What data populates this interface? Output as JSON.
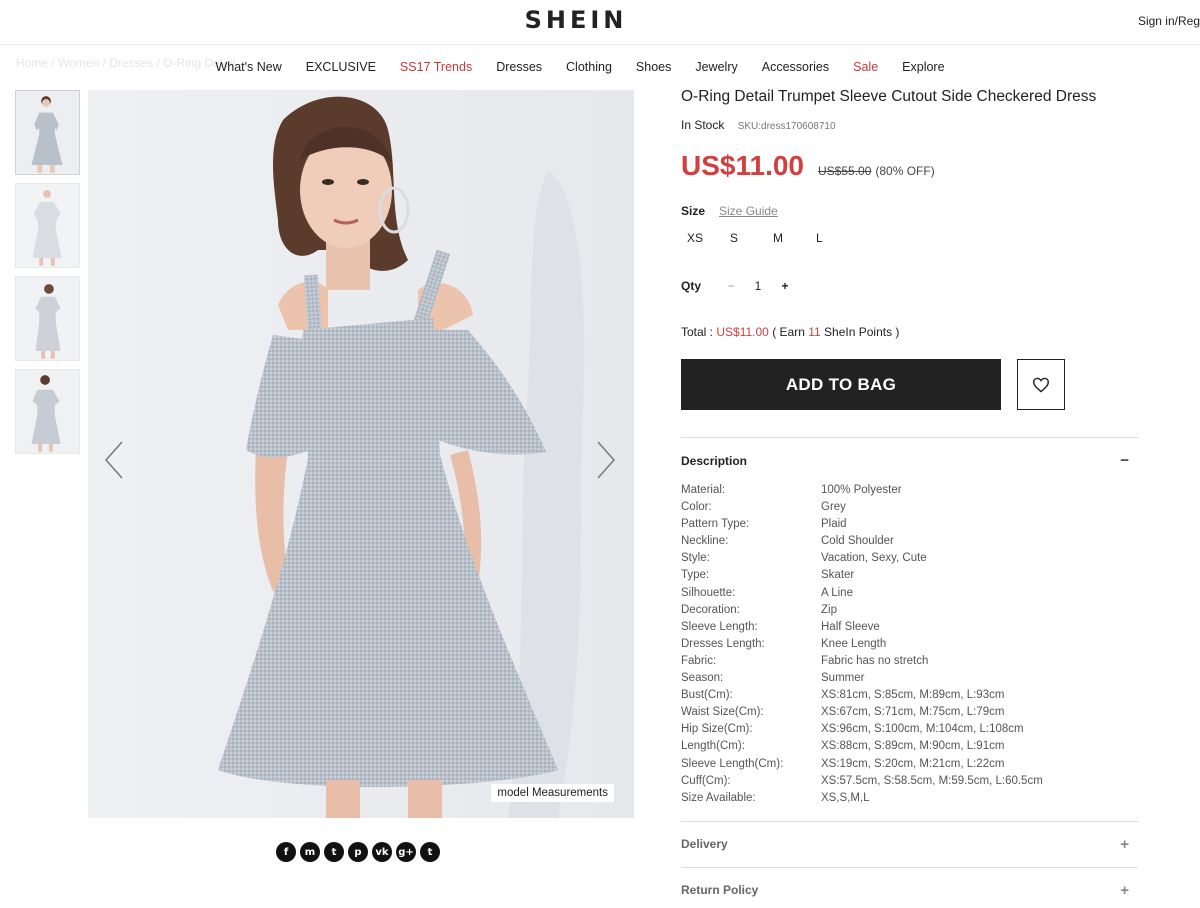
{
  "header": {
    "logo": "SHEIN",
    "signin": "Sign in/Reg"
  },
  "breadcrumb": "Home / Women / Dresses / O-Ring Detail",
  "nav": {
    "items": [
      {
        "label": "What's New",
        "highlight": false
      },
      {
        "label": "EXCLUSIVE",
        "highlight": false
      },
      {
        "label": "SS17 Trends",
        "highlight": true
      },
      {
        "label": "Dresses",
        "highlight": false
      },
      {
        "label": "Clothing",
        "highlight": false
      },
      {
        "label": "Shoes",
        "highlight": false
      },
      {
        "label": "Jewelry",
        "highlight": false
      },
      {
        "label": "Accessories",
        "highlight": false
      },
      {
        "label": "Sale",
        "highlight": true
      },
      {
        "label": "Explore",
        "highlight": false
      }
    ]
  },
  "gallery": {
    "model_measurements": "model Measurements",
    "thumbnail_count": 4
  },
  "product": {
    "title": "O-Ring Detail Trumpet Sleeve Cutout Side Checkered Dress",
    "stock": "In Stock",
    "sku": "SKU:dress170608710",
    "price": "US$11.00",
    "old_price": "US$55.00",
    "discount": "(80% OFF)",
    "size_label": "Size",
    "size_guide": "Size Guide",
    "sizes": [
      "XS",
      "S",
      "M",
      "L"
    ],
    "qty_label": "Qty",
    "qty_minus": "−",
    "qty_value": "1",
    "qty_plus": "+",
    "total_label": "Total :",
    "total_price": "US$11.00",
    "earn_prefix": "( Earn",
    "earn_points": "11",
    "earn_suffix": "SheIn Points )",
    "add_to_bag": "ADD TO BAG"
  },
  "description": {
    "heading": "Description",
    "collapse_sign": "−",
    "rows": [
      {
        "key": "Material:",
        "value": "100% Polyester"
      },
      {
        "key": "Color:",
        "value": "Grey"
      },
      {
        "key": "Pattern Type:",
        "value": "Plaid"
      },
      {
        "key": "Neckline:",
        "value": "Cold Shoulder"
      },
      {
        "key": "Style:",
        "value": "Vacation, Sexy, Cute"
      },
      {
        "key": "Type:",
        "value": "Skater"
      },
      {
        "key": "Silhouette:",
        "value": "A Line"
      },
      {
        "key": "Decoration:",
        "value": "Zip"
      },
      {
        "key": "Sleeve Length:",
        "value": "Half Sleeve"
      },
      {
        "key": "Dresses Length:",
        "value": "Knee Length"
      },
      {
        "key": "Fabric:",
        "value": "Fabric has no stretch"
      },
      {
        "key": "Season:",
        "value": "Summer"
      },
      {
        "key": "Bust(Cm):",
        "value": "XS:81cm, S:85cm, M:89cm, L:93cm"
      },
      {
        "key": "Waist Size(Cm):",
        "value": "XS:67cm, S:71cm, M:75cm, L:79cm"
      },
      {
        "key": "Hip Size(Cm):",
        "value": "XS:96cm, S:100cm, M:104cm, L:108cm"
      },
      {
        "key": "Length(Cm):",
        "value": "XS:88cm, S:89cm, M:90cm, L:91cm"
      },
      {
        "key": "Sleeve Length(Cm):",
        "value": "XS:19cm, S:20cm, M:21cm, L:22cm"
      },
      {
        "key": "Cuff(Cm):",
        "value": "XS:57.5cm, S:58.5cm, M:59.5cm, L:60.5cm"
      },
      {
        "key": "Size Available:",
        "value": "XS,S,M,L"
      }
    ]
  },
  "delivery": {
    "heading": "Delivery",
    "sign": "+"
  },
  "return_policy": {
    "heading": "Return Policy",
    "sign": "+"
  },
  "social": [
    {
      "icon": "facebook-icon",
      "glyph": "f"
    },
    {
      "icon": "messenger-icon",
      "glyph": "m"
    },
    {
      "icon": "twitter-icon",
      "glyph": "t"
    },
    {
      "icon": "pinterest-icon",
      "glyph": "p"
    },
    {
      "icon": "vk-icon",
      "glyph": "vk"
    },
    {
      "icon": "google-plus-icon",
      "glyph": "g+"
    },
    {
      "icon": "tumblr-icon",
      "glyph": "t"
    }
  ],
  "colors": {
    "accent_red": "#d23f3f",
    "button_dark": "#222222"
  }
}
